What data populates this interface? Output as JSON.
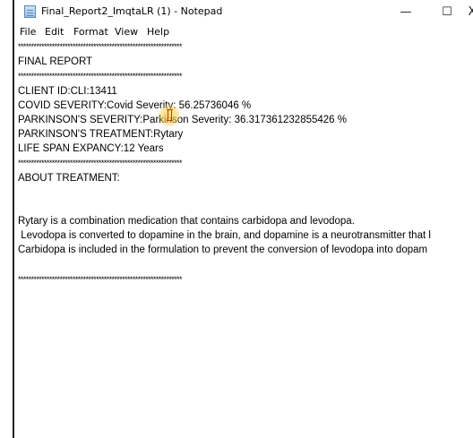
{
  "window": {
    "title": "Final_Report2_ImqtaLR (1) - Notepad",
    "controls": {
      "minimize": "—",
      "maximize": "☐",
      "close": "X"
    }
  },
  "menu": [
    "File",
    "Edit",
    "Format",
    "View",
    "Help"
  ],
  "document": {
    "lines": [
      "***************************************************************",
      "FINAL REPORT",
      "***************************************************************",
      "CLIENT ID:CLI:13411",
      "COVID SEVERITY:Covid Severity: 56.25736046 %",
      "PARKINSON'S SEVERITY:Parkinson Severity: 36.317361232855426 %",
      "PARKINSON'S TREATMENT:Rytary",
      "LIFE SPAN EXPANCY:12 Years",
      "***************************************************************",
      "ABOUT TREATMENT:",
      "",
      "",
      "Rytary is a combination medication that contains carbidopa and levodopa.",
      " Levodopa is converted to dopamine in the brain, and dopamine is a neurotransmitter that l",
      "Carbidopa is included in the formulation to prevent the conversion of levodopa into dopam",
      "",
      "***************************************************************"
    ]
  }
}
